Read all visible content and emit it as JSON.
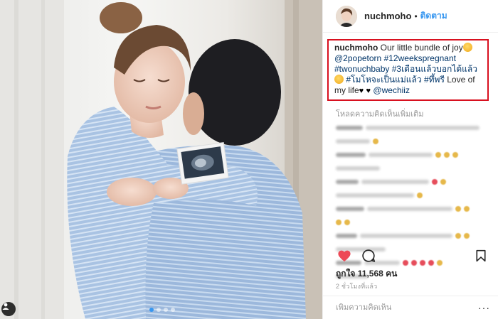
{
  "post": {
    "username": "nuchmoho",
    "separator": "•",
    "follow_label": "ติดตาม"
  },
  "caption": {
    "username": "nuchmoho",
    "text1": " Our little bundle of joy",
    "mention1": "@2popetorn",
    "hashtag1": "#12weekspregnant",
    "hashtag2": "#twonuchbaby",
    "hashtag3": "#3เดือนแล้วบอกได้แล้ว",
    "hashtag4": "#โมโหจะเป็นแม่แล้ว",
    "hashtag5": "#ทึ้พรี",
    "text2": " Love of my life",
    "heart": "♥",
    "mention2": "@wechiiz"
  },
  "comments": {
    "load_more": "โหลดความคิดเห็นเพิ่มเติม"
  },
  "stats": {
    "likes": "ถูกใจ 11,568 คน",
    "time_ago": "2 ชั่วโมงที่แล้ว"
  },
  "add_comment": {
    "placeholder": "เพิ่มความคิดเห็น",
    "more": "···"
  },
  "icons": {
    "like": "heart-filled-icon",
    "comment": "comment-bubble-icon",
    "save": "bookmark-icon",
    "tag": "person-tag-icon"
  },
  "colors": {
    "accent": "#3897f0",
    "like": "#ed4956",
    "highlight_border": "#d8101f",
    "hashtag": "#003569"
  },
  "carousel": {
    "count": 4,
    "active_index": 0
  }
}
